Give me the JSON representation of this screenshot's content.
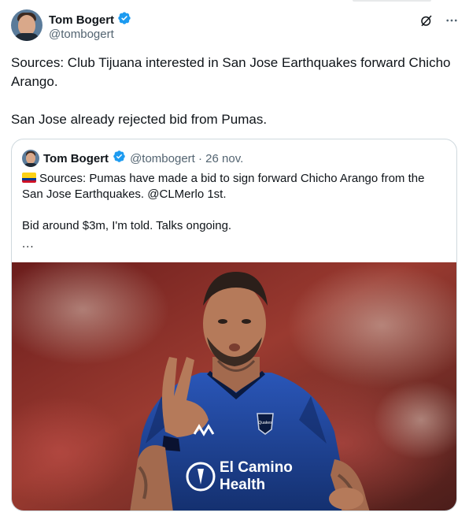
{
  "author": {
    "display_name": "Tom Bogert",
    "handle": "@tombogert",
    "verified": true
  },
  "actions": {
    "grok_icon": "slashed-circle-icon",
    "more_icon": "more-horizontal-icon"
  },
  "tweet": {
    "line1": "Sources: Club Tijuana interested in San Jose Earthquakes forward Chicho Arango.",
    "line2": "San Jose already rejected bid from Pumas."
  },
  "quoted": {
    "display_name": "Tom Bogert",
    "meta": "@tombogert · 26 nov.",
    "flag": "colombia-flag",
    "text1": "Sources: Pumas have made a bid to sign forward Chicho Arango from the San Jose Earthquakes. @CLMerlo 1st.",
    "text2": "Bid around $3m, I'm told. Talks ongoing.",
    "more": "...",
    "image": {
      "sponsor_line1": "El Camino",
      "sponsor_line2": "Health",
      "badge_text": "Quakes"
    }
  },
  "colors": {
    "text": "#0f1419",
    "secondary": "#536471",
    "verified": "#1d9bf0",
    "border": "#cfd9de",
    "jersey": "#1c3f94"
  }
}
